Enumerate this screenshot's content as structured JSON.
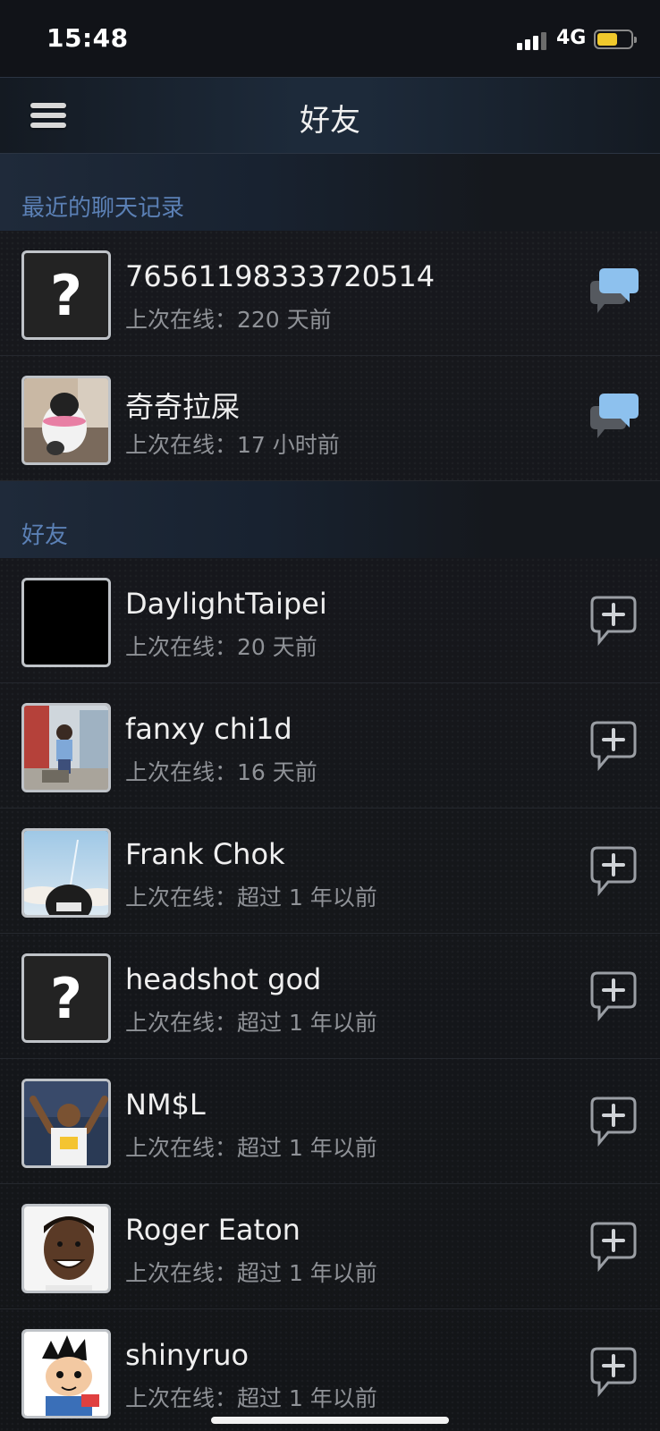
{
  "status_bar": {
    "time": "15:48",
    "network": "4G",
    "battery_level_pct": 60,
    "signal_bars_active": 3
  },
  "header": {
    "title": "好友",
    "menu_icon": "hamburger-menu-icon"
  },
  "recent_section": {
    "title": "最近的聊天记录",
    "items": [
      {
        "name": "76561198333720514",
        "status": "上次在线：220 天前",
        "avatar": "unknown-avatar",
        "action_icon": "chat-bubbles-icon"
      },
      {
        "name": "奇奇拉屎",
        "status": "上次在线：17 小时前",
        "avatar": "cat-photo-avatar",
        "action_icon": "chat-bubbles-icon"
      }
    ]
  },
  "friends_section": {
    "title": "好友",
    "items": [
      {
        "name": "DaylightTaipei",
        "status": "上次在线：20 天前",
        "avatar": "black-avatar",
        "action_icon": "add-chat-icon"
      },
      {
        "name": "fanxy chi1d",
        "status": "上次在线：16 天前",
        "avatar": "photo-avatar",
        "action_icon": "add-chat-icon"
      },
      {
        "name": "Frank Chok",
        "status": "上次在线：超过 1 年以前",
        "avatar": "photo-avatar",
        "action_icon": "add-chat-icon"
      },
      {
        "name": "headshot god",
        "status": "上次在线：超过 1 年以前",
        "avatar": "unknown-avatar",
        "action_icon": "add-chat-icon"
      },
      {
        "name": "NM$L",
        "status": "上次在线：超过 1 年以前",
        "avatar": "photo-avatar",
        "action_icon": "add-chat-icon"
      },
      {
        "name": "Roger Eaton",
        "status": "上次在线：超过 1 年以前",
        "avatar": "photo-avatar",
        "action_icon": "add-chat-icon"
      },
      {
        "name": "shinyruo",
        "status": "上次在线：超过 1 年以前",
        "avatar": "cartoon-avatar",
        "action_icon": "add-chat-icon"
      }
    ]
  },
  "colors": {
    "section_label": "#5b80b5",
    "accent_bubble": "#7fb6e6"
  }
}
